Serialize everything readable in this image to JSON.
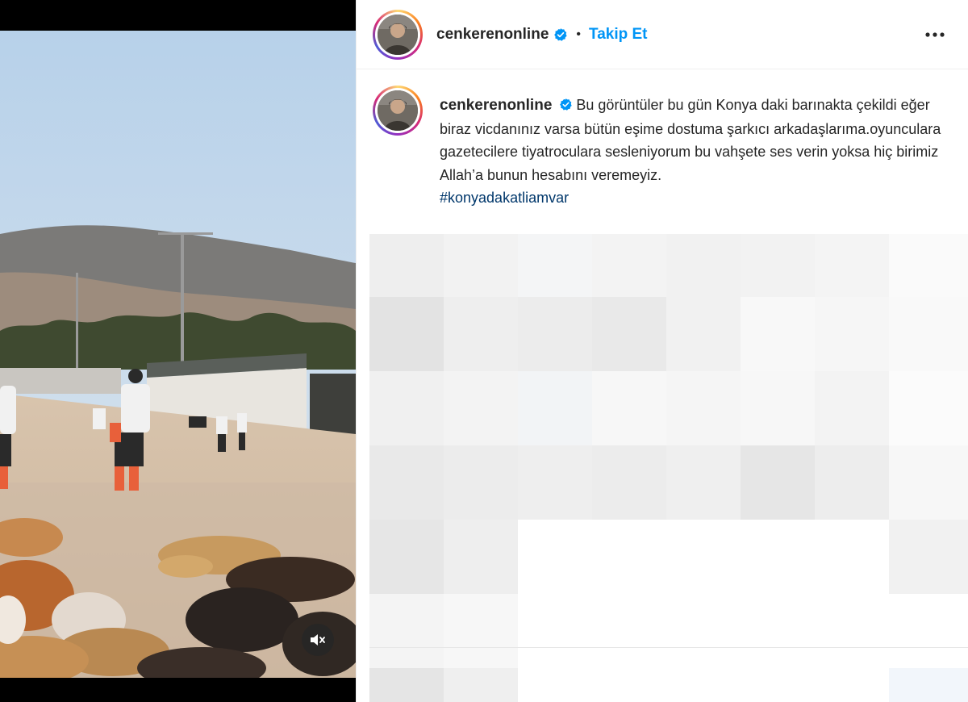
{
  "post": {
    "username": "cenkerenonline",
    "follow_label": "Takip Et",
    "separator": "•",
    "more_label": "•••",
    "caption": "Bu görüntüler bu gün Konya daki barınakta çekildi eğer biraz vicdanınız varsa bütün eşime dostuma şarkıcı arkadaşlarıma.oyunculara gazetecilere tiyatroculara sesleniyorum bu vahşete ses verin yoksa hiç birimiz Allah’a bunun hesabını veremeyiz.",
    "hashtag": "#konyadakatliamvar"
  },
  "icons": {
    "verified": "verified-badge-icon",
    "mute": "speaker-muted-icon",
    "more": "more-options-icon"
  },
  "colors": {
    "follow_blue": "#0095f6",
    "verified_blue": "#0095f6",
    "hashtag": "#00376b",
    "text": "#262626"
  }
}
